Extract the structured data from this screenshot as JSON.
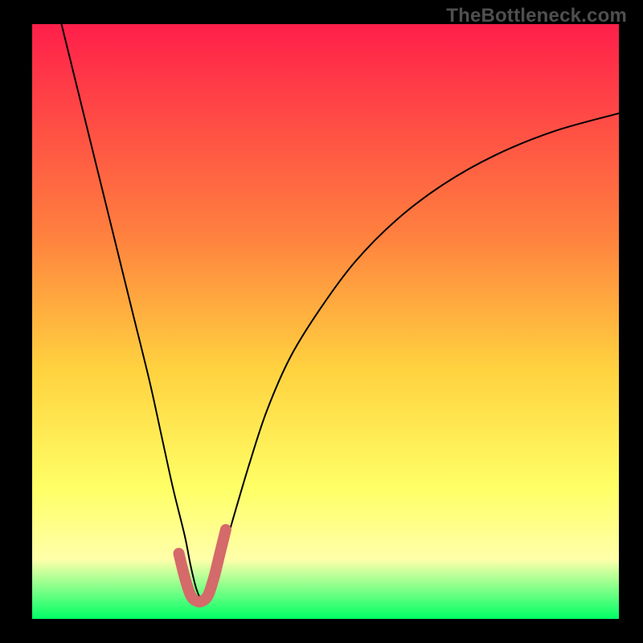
{
  "watermark": "TheBottleneck.com",
  "colors": {
    "background": "#000000",
    "gradient_top": "#ff1f4a",
    "gradient_mid_upper": "#ff7f3f",
    "gradient_mid": "#ffd23f",
    "gradient_mid_lower": "#ffff66",
    "gradient_pale": "#ffffaa",
    "gradient_bottom": "#00ff66",
    "curve": "#000000",
    "accent": "#d46a6a"
  },
  "chart_data": {
    "type": "line",
    "title": "",
    "xlabel": "",
    "ylabel": "",
    "xlim": [
      0,
      100
    ],
    "ylim": [
      0,
      100
    ],
    "series": [
      {
        "name": "bottleneck-curve",
        "x": [
          5,
          8,
          11,
          14,
          17,
          20,
          22,
          24,
          26,
          27,
          28,
          29,
          30,
          31,
          32,
          34,
          37,
          40,
          44,
          49,
          55,
          62,
          70,
          79,
          89,
          100
        ],
        "y": [
          100,
          88,
          76,
          64,
          52,
          40,
          31,
          22,
          14,
          9,
          5,
          3,
          3,
          5,
          9,
          16,
          26,
          35,
          44,
          52,
          60,
          67,
          73,
          78,
          82,
          85
        ]
      }
    ],
    "accent_segment": {
      "name": "valley-u",
      "x": [
        25,
        26,
        27,
        28,
        29,
        30,
        31,
        32,
        33
      ],
      "y": [
        11,
        7,
        4,
        3,
        3,
        4,
        7,
        11,
        15
      ]
    },
    "gradient_stops": [
      {
        "offset": 0.0,
        "key": "gradient_top"
      },
      {
        "offset": 0.35,
        "key": "gradient_mid_upper"
      },
      {
        "offset": 0.58,
        "key": "gradient_mid"
      },
      {
        "offset": 0.78,
        "key": "gradient_mid_lower"
      },
      {
        "offset": 0.9,
        "key": "gradient_pale"
      },
      {
        "offset": 1.0,
        "key": "gradient_bottom"
      }
    ]
  }
}
